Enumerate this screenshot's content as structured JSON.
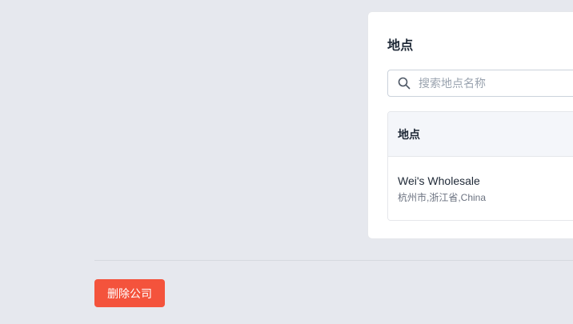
{
  "locations_card": {
    "title": "地点",
    "search": {
      "placeholder": "搜索地点名称",
      "value": "",
      "icon": "search-icon"
    },
    "table": {
      "header": "地点",
      "rows": [
        {
          "name": "Wei's Wholesale",
          "address": "杭州市,浙江省,China"
        }
      ]
    }
  },
  "actions": {
    "delete_company_label": "删除公司"
  },
  "colors": {
    "background": "#e6e8ee",
    "card": "#ffffff",
    "danger": "#f4533c",
    "header_bg": "#f4f6fa"
  }
}
